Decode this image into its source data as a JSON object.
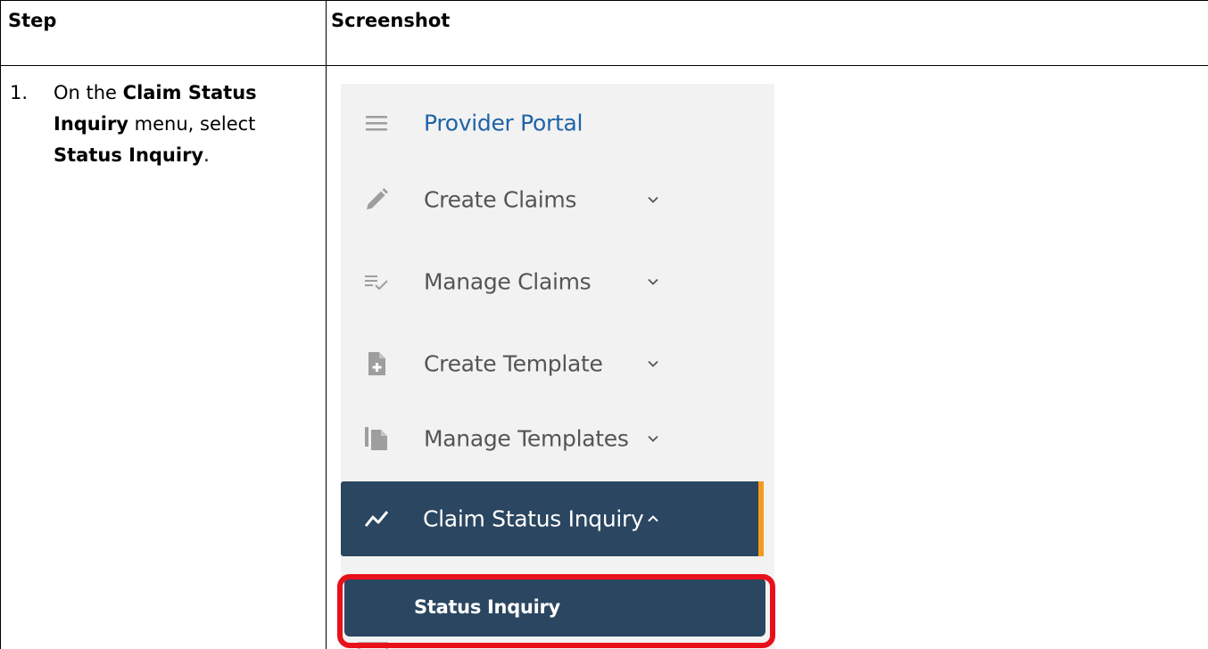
{
  "table": {
    "header_step": "Step",
    "header_screenshot": "Screenshot"
  },
  "step": {
    "number": "1.",
    "text_prefix": "On the ",
    "menu_name": "Claim Status Inquiry",
    "text_middle": " menu, select ",
    "item_name": "Status Inquiry",
    "text_suffix": "."
  },
  "menu": {
    "brand": {
      "label": "Provider Portal",
      "icon": "hamburger-icon"
    },
    "items": [
      {
        "label": "Create Claims",
        "icon": "pencil-icon",
        "expanded": false
      },
      {
        "label": "Manage Claims",
        "icon": "list-check-icon",
        "expanded": false
      },
      {
        "label": "Create Template",
        "icon": "document-plus-icon",
        "expanded": false
      },
      {
        "label": "Manage Templates",
        "icon": "documents-icon",
        "expanded": false
      },
      {
        "label": "Claim Status Inquiry",
        "icon": "trend-line-icon",
        "expanded": true
      }
    ],
    "sub_items": [
      {
        "label": "Status Inquiry"
      }
    ]
  },
  "colors": {
    "brand": "#1e63a8",
    "active_bg": "#2b4660",
    "accent": "#f39a1d",
    "highlight": "#e8101a",
    "menu_bg": "#f2f2f2",
    "icon_gray": "#9e9e9e"
  }
}
